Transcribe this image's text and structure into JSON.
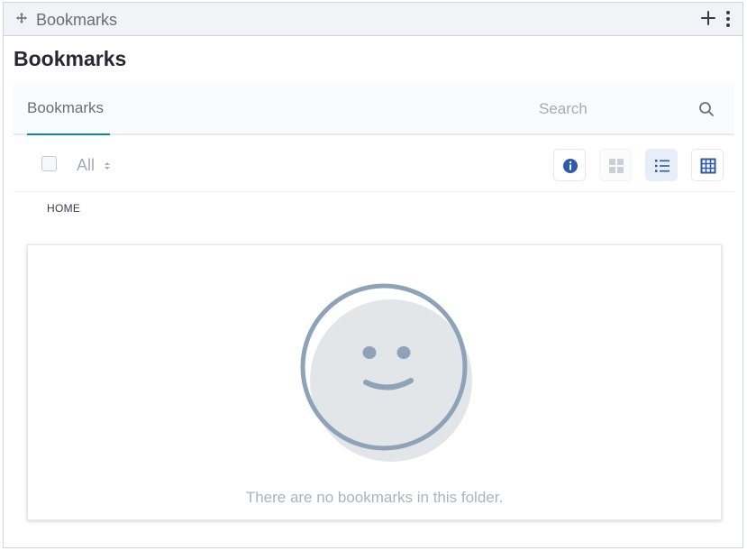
{
  "portlet": {
    "topper_title": "Bookmarks",
    "icons": [
      "move-icon",
      "plus-icon",
      "kebab-icon"
    ]
  },
  "page": {
    "title": "Bookmarks"
  },
  "navigation": {
    "tabs": [
      {
        "label": "Bookmarks",
        "active": true
      }
    ],
    "search": {
      "placeholder": "Search",
      "value": ""
    }
  },
  "management_toolbar": {
    "filter_label": "All",
    "view_buttons": [
      {
        "name": "info",
        "icon": "info-circle-icon",
        "active": false
      },
      {
        "name": "cards",
        "icon": "cards-icon",
        "active": false
      },
      {
        "name": "list",
        "icon": "list-icon",
        "active": true
      },
      {
        "name": "table",
        "icon": "table-icon",
        "active": false
      }
    ]
  },
  "breadcrumb": {
    "items": [
      "HOME"
    ]
  },
  "empty_state": {
    "message": "There are no bookmarks in this folder.",
    "illustration": "smiley-face-icon"
  },
  "colors": {
    "accent": "#0b8a8f",
    "primary": "#2e5aac",
    "border": "#cdd6e0",
    "illustration_stroke": "#8ea3b8",
    "illustration_fill": "#e3e6e9"
  }
}
